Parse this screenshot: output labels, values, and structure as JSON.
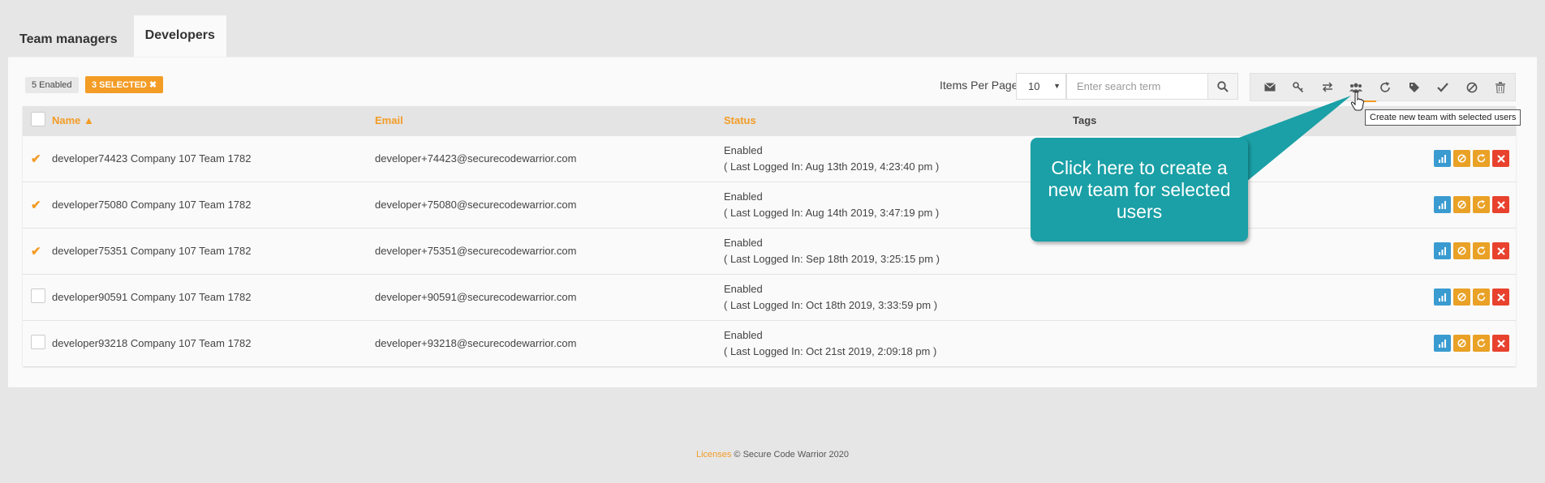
{
  "tabs": [
    {
      "label": "Team managers"
    },
    {
      "label": "Developers"
    }
  ],
  "badges": {
    "enabled": "5 Enabled",
    "selected": "3 SELECTED ✖"
  },
  "pagination": {
    "items_per_page_label": "Items Per Page:",
    "items_per_page_value": "10"
  },
  "search": {
    "placeholder": "Enter search term"
  },
  "toolbar": {
    "icons": [
      "envelope-icon",
      "key-icon",
      "transfer-icon",
      "users-icon",
      "refresh-icon",
      "tag-icon",
      "check-icon",
      "ban-icon",
      "trash-icon"
    ]
  },
  "tooltip": "Create new team with selected users",
  "table": {
    "headers": {
      "name": "Name",
      "email": "Email",
      "status": "Status",
      "tags": "Tags"
    },
    "rows": [
      {
        "name": "developer74423 Company 107 Team 1782",
        "email": "developer+74423@securecodewarrior.com",
        "status": "Enabled",
        "last_login": "( Last Logged In: Aug 13th 2019, 4:23:40 pm )",
        "selected": true
      },
      {
        "name": "developer75080 Company 107 Team 1782",
        "email": "developer+75080@securecodewarrior.com",
        "status": "Enabled",
        "last_login": "( Last Logged In: Aug 14th 2019, 3:47:19 pm )",
        "selected": true
      },
      {
        "name": "developer75351 Company 107 Team 1782",
        "email": "developer+75351@securecodewarrior.com",
        "status": "Enabled",
        "last_login": "( Last Logged In: Sep 18th 2019, 3:25:15 pm )",
        "selected": true
      },
      {
        "name": "developer90591 Company 107 Team 1782",
        "email": "developer+90591@securecodewarrior.com",
        "status": "Enabled",
        "last_login": "( Last Logged In: Oct 18th 2019, 3:33:59 pm )",
        "selected": false
      },
      {
        "name": "developer93218 Company 107 Team 1782",
        "email": "developer+93218@securecodewarrior.com",
        "status": "Enabled",
        "last_login": "( Last Logged In: Oct 21st 2019, 2:09:18 pm )",
        "selected": false
      }
    ]
  },
  "callout": "Click here to create a new team for selected users",
  "footer": {
    "link": "Licenses",
    "text": " © Secure Code Warrior 2020"
  },
  "colors": {
    "accent": "#f39c26",
    "callout": "#1aa0a6",
    "stats_button": "#3a9bd0",
    "delete_button": "#e8422e"
  }
}
